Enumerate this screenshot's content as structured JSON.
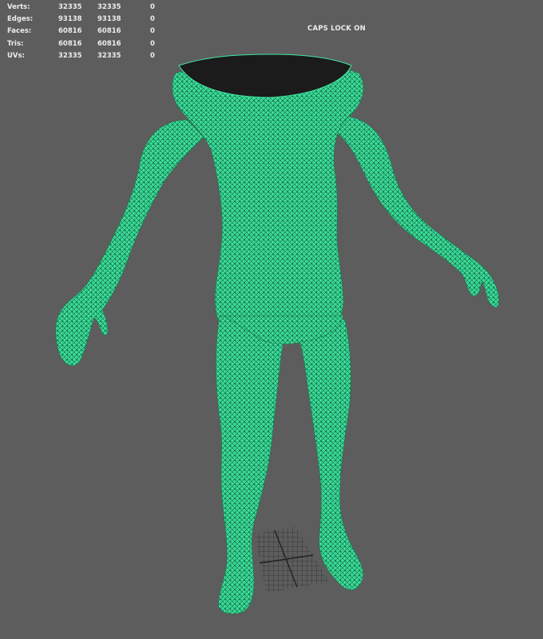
{
  "hud": {
    "stats": [
      {
        "label": "Verts:",
        "a": "32335",
        "b": "32335",
        "c": "0"
      },
      {
        "label": "Edges:",
        "a": "93138",
        "b": "93138",
        "c": "0"
      },
      {
        "label": "Faces:",
        "a": "60816",
        "b": "60816",
        "c": "0"
      },
      {
        "label": "Tris:",
        "a": "60816",
        "b": "60816",
        "c": "0"
      },
      {
        "label": "UVs:",
        "a": "32335",
        "b": "32335",
        "c": "0"
      }
    ],
    "caps_lock": "CAPS LOCK ON"
  },
  "colors": {
    "background": "#5d5d5d",
    "wireframe_fill": "#3ee6a0",
    "wireframe_line": "#0f5a3a",
    "hud_text": "#ececec",
    "grid_line": "#2e2e2e"
  },
  "scene": {
    "object": "human-body-mesh",
    "display_mode": "wireframe-on-shaded",
    "grid": true
  }
}
